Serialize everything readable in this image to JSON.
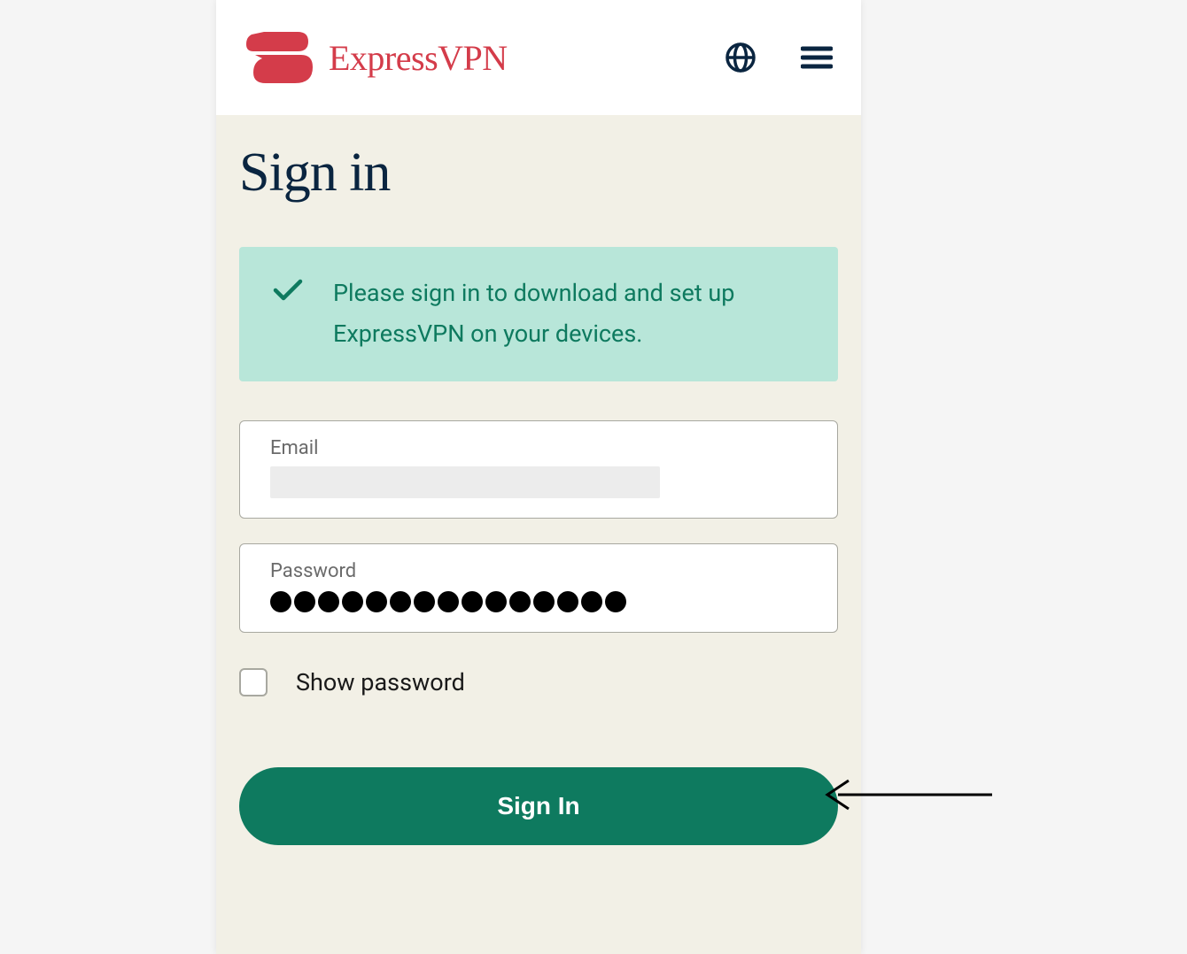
{
  "brand": {
    "name": "ExpressVPN"
  },
  "page": {
    "title": "Sign in"
  },
  "notice": {
    "message": "Please sign in to download and set up ExpressVPN on your devices."
  },
  "form": {
    "email": {
      "label": "Email",
      "value": ""
    },
    "password": {
      "label": "Password",
      "value": "•••••••••••••••",
      "dot_count": 15
    },
    "show_password": {
      "label": "Show password",
      "checked": false
    },
    "submit": {
      "label": "Sign In"
    }
  },
  "colors": {
    "brand_red": "#d43c4a",
    "brand_green": "#0e7a5f",
    "notice_bg": "#b8e6d9",
    "content_bg": "#f2f0e6",
    "dark_navy": "#0a2540"
  }
}
